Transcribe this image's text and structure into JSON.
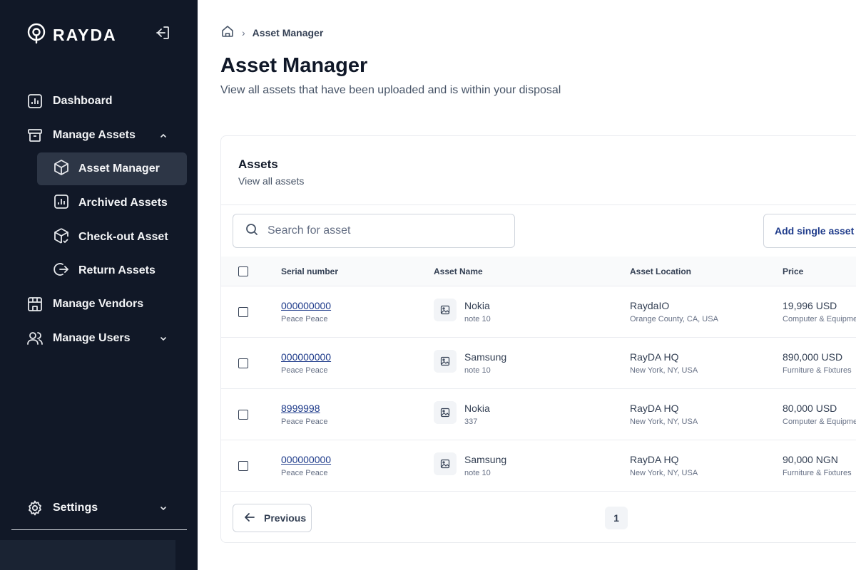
{
  "brand": {
    "name": "RAYDA"
  },
  "sidebar": {
    "items": [
      {
        "label": "Dashboard"
      },
      {
        "label": "Manage Assets"
      },
      {
        "label": "Manage Vendors"
      },
      {
        "label": "Manage Users"
      },
      {
        "label": "Settings"
      }
    ],
    "sub_items": [
      {
        "label": "Asset Manager",
        "active": true
      },
      {
        "label": "Archived Assets"
      },
      {
        "label": "Check-out Asset"
      },
      {
        "label": "Return Assets"
      }
    ]
  },
  "breadcrumb": {
    "current": "Asset Manager",
    "separator": "›"
  },
  "page": {
    "title": "Asset Manager",
    "subtitle": "View all assets that have been uploaded and is within your disposal"
  },
  "card": {
    "title": "Assets",
    "subtitle": "View all assets",
    "search_placeholder": "Search for asset",
    "add_button": "Add single asset"
  },
  "table": {
    "columns": [
      "Serial number",
      "Asset Name",
      "Asset Location",
      "Price"
    ],
    "rows": [
      {
        "serial": "000000000",
        "owner": "Peace Peace",
        "name": "Nokia",
        "note": "note 10",
        "location": "RaydaIO",
        "address": "Orange County, CA, USA",
        "price": "19,996 USD",
        "category": "Computer & Equipme"
      },
      {
        "serial": "000000000",
        "owner": "Peace Peace",
        "name": "Samsung",
        "note": "note 10",
        "location": "RayDA HQ",
        "address": "New York, NY, USA",
        "price": "890,000 USD",
        "category": "Furniture & Fixtures"
      },
      {
        "serial": "8999998",
        "owner": "Peace Peace",
        "name": "Nokia",
        "note": "337",
        "location": "RayDA HQ",
        "address": "New York, NY, USA",
        "price": "80,000 USD",
        "category": "Computer & Equipme"
      },
      {
        "serial": "000000000",
        "owner": "Peace Peace",
        "name": "Samsung",
        "note": "note 10",
        "location": "RayDA HQ",
        "address": "New York, NY, USA",
        "price": "90,000 NGN",
        "category": "Furniture & Fixtures"
      }
    ]
  },
  "pagination": {
    "previous": "Previous",
    "current_page": "1"
  },
  "colors": {
    "sidebar_bg": "#111827",
    "accent": "#1d3a8a",
    "active_item": "#2d3646"
  },
  "icons": {
    "logo": "rayda-pin-icon",
    "collapse": "logout-arrow-icon",
    "dashboard": "bar-chart-icon",
    "manage_assets": "archive-box-icon",
    "asset_manager": "cube-icon",
    "archived": "bar-chart-icon",
    "checkout": "cube-check-icon",
    "return": "logout-icon",
    "vendors": "store-icon",
    "users": "users-icon",
    "settings": "gear-icon",
    "home": "home-icon",
    "search": "search-icon",
    "image": "image-placeholder-icon",
    "previous": "arrow-left-icon"
  }
}
